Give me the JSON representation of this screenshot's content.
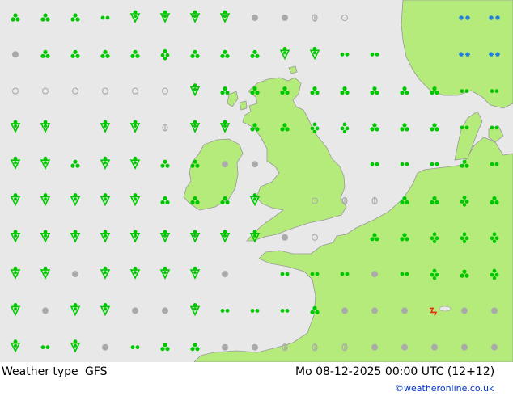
{
  "map": {
    "title": "Weather type",
    "model": "GFS",
    "valid_time": "Mo 08-12-2025 00:00 UTC (12+12)",
    "credit": "©weatheronline.co.uk",
    "colors": {
      "sea": "#e8e8e8",
      "land": "#b4eb7b",
      "coast": "#999999",
      "rain": "#00c800",
      "snow": "#1e7ddc",
      "dry": "#aaaaaa",
      "thunder": "#e03010"
    },
    "symbol_legend": {
      "rs": "rain shower",
      "rd": "heavy rain",
      "rr": "rain",
      "r2": "drizzle",
      "sn": "snow",
      "ov": "overcast",
      "pc": "partly cloudy",
      "cl": "cloudy",
      "th": "thunder"
    },
    "grid": [
      [
        "rs",
        "rs",
        "rs",
        "r2",
        "rd",
        "rd",
        "rd",
        "rd",
        "ov",
        "ov",
        "pc",
        "cl",
        "",
        "",
        "",
        "sn",
        "sn"
      ],
      [
        "ov",
        "rs",
        "rs",
        "rs",
        "rs",
        "rr",
        "rs",
        "rs",
        "rs",
        "rd",
        "rd",
        "r2",
        "r2",
        "",
        "",
        "sn",
        "sn"
      ],
      [
        "cl",
        "cl",
        "cl",
        "cl",
        "cl",
        "cl",
        "rd",
        "rs",
        "rs",
        "rs",
        "rs",
        "rs",
        "rs",
        "rs",
        "rs",
        "r2",
        "r2"
      ],
      [
        "rd",
        "rd",
        "",
        "rd",
        "rd",
        "pc",
        "rd",
        "rd",
        "rs",
        "rs",
        "rr",
        "rr",
        "rs",
        "rs",
        "rs",
        "r2",
        "r2"
      ],
      [
        "rd",
        "rd",
        "rs",
        "rd",
        "rd",
        "rs",
        "rs",
        "ov",
        "ov",
        "",
        "",
        "",
        "r2",
        "r2",
        "r2",
        "rs",
        "r2"
      ],
      [
        "rd",
        "rd",
        "rd",
        "rd",
        "rd",
        "rs",
        "rs",
        "rs",
        "rd",
        "",
        "cl",
        "pc",
        "pc",
        "rs",
        "rs",
        "rr",
        "rs"
      ],
      [
        "rd",
        "rd",
        "rd",
        "rd",
        "rd",
        "rd",
        "rd",
        "rd",
        "rd",
        "ov",
        "cl",
        "",
        "rs",
        "rs",
        "rr",
        "rr",
        "rr"
      ],
      [
        "rd",
        "rd",
        "ov",
        "rd",
        "rd",
        "rd",
        "rd",
        "ov",
        "",
        "r2",
        "r2",
        "r2",
        "ov",
        "r2",
        "rr",
        "rs",
        "rr"
      ],
      [
        "rd",
        "ov",
        "rd",
        "rd",
        "ov",
        "ov",
        "rd",
        "r2",
        "r2",
        "r2",
        "rs",
        "ov",
        "ov",
        "ov",
        "th",
        "ov",
        "ov"
      ],
      [
        "rd",
        "r2",
        "rd",
        "ov",
        "r2",
        "rs",
        "rs",
        "ov",
        "ov",
        "pc",
        "pc",
        "pc",
        "ov",
        "ov",
        "ov",
        "ov",
        "ov"
      ]
    ]
  }
}
